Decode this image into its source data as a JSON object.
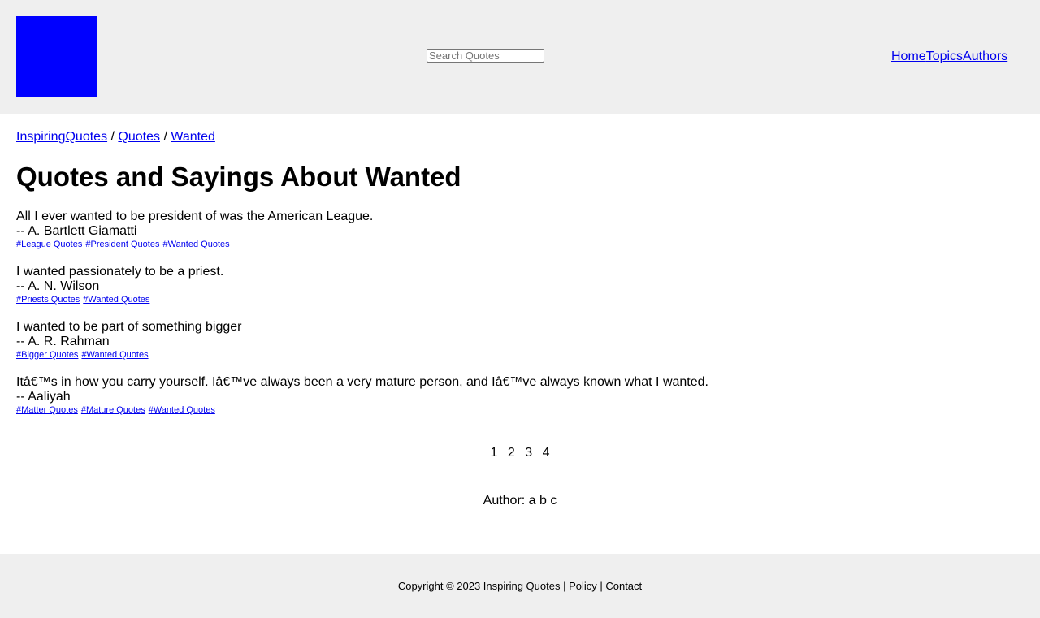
{
  "header": {
    "logo_color": "#0000ff",
    "search_placeholder": "Search Quotes",
    "nav": [
      "Home",
      "Topics",
      "Authors"
    ]
  },
  "breadcrumb": {
    "site": "InspiringQuotes",
    "sep1": " / ",
    "quotes": "Quotes",
    "sep2": " / ",
    "topic": "Wanted"
  },
  "page_title": "Quotes and Sayings About Wanted",
  "quotes": [
    {
      "text": "All I ever wanted to be president of was the American League.",
      "author": "-- A. Bartlett Giamatti",
      "tags": [
        "#League Quotes",
        "#President Quotes",
        "#Wanted Quotes"
      ]
    },
    {
      "text": "I wanted passionately to be a priest.",
      "author": "-- A. N. Wilson",
      "tags": [
        "#Priests Quotes",
        "#Wanted Quotes"
      ]
    },
    {
      "text": "I wanted to be part of something bigger",
      "author": "-- A. R. Rahman",
      "tags": [
        "#Bigger Quotes",
        "#Wanted Quotes"
      ]
    },
    {
      "text": "Itâ€™s in how you carry yourself. Iâ€™ve always been a very mature person, and Iâ€™ve always known what I wanted.",
      "author": "-- Aaliyah",
      "tags": [
        "#Matter Quotes",
        "#Mature Quotes",
        "#Wanted Quotes"
      ]
    }
  ],
  "pagination": [
    "1",
    "2",
    "3",
    "4"
  ],
  "author_filter": "Author: a b c",
  "footer": "Copyright © 2023 Inspiring Quotes | Policy | Contact"
}
